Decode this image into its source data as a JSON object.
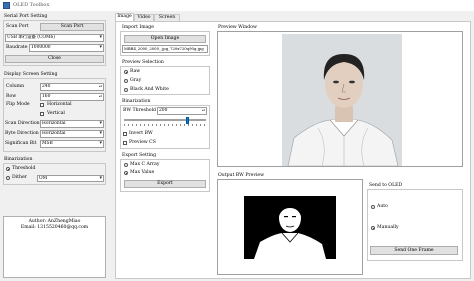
{
  "window": {
    "title": "OLED Toolbox"
  },
  "serial": {
    "group_title": "Serial Port Setting",
    "scan_label": "Scan Port",
    "scan_button": "Scan Port",
    "port_value": "USB 串行设备 (COM6)",
    "baud_label": "Baudrate",
    "baud_value": "1000000",
    "close_button": "Close"
  },
  "display": {
    "group_title": "Display Screen Setting",
    "column_label": "Column",
    "column_value": "240",
    "row_label": "Row",
    "row_value": "160",
    "flip_label": "Flip Mode",
    "horizontal_label": "Horizontal",
    "vertical_label": "Vertical",
    "scan_dir_label": "Scan Direction",
    "scan_dir_value": "Horizontal",
    "byte_dir_label": "Byte Direction",
    "byte_dir_value": "Horizontal",
    "sigbit_label": "Significan Bit",
    "sigbit_value": "MSB"
  },
  "binarization_left": {
    "group_title": "Binarization",
    "threshold_label": "Threshold",
    "dither_label": "Dither",
    "dither_value": "OM"
  },
  "author": {
    "line1": "Author: AnZhengMiao",
    "line2": "Email: 1315520460@qq.com"
  },
  "tabs": [
    "Image",
    "Video",
    "Screen"
  ],
  "import_image": {
    "group_title": "Import Image",
    "open_button": "Open Image",
    "path_value": "MBB4_2000_2000_.jpg_720x720q90g.jpg"
  },
  "preview_selection": {
    "group_title": "Preview Selection",
    "options": [
      "Raw",
      "Gray",
      "Black And White"
    ]
  },
  "binarization_right": {
    "group_title": "Binarization",
    "threshold_label": "BW Threshold",
    "threshold_value": "200",
    "threshold_fraction": 0.78,
    "invert_label": "Invert BW",
    "preview_cs_label": "Preview CS"
  },
  "export": {
    "group_title": "Export Setting",
    "max_c_array_label": "Max C Array",
    "max_value_label": "Max Value",
    "export_button": "Export"
  },
  "preview_window": {
    "title": "Preview Window"
  },
  "output_preview": {
    "title": "Output BW Preview"
  },
  "send_oled": {
    "group_title": "Send to OLED",
    "auto_label": "Auto",
    "manually_label": "Manually",
    "send_button": "Send One Frame"
  }
}
